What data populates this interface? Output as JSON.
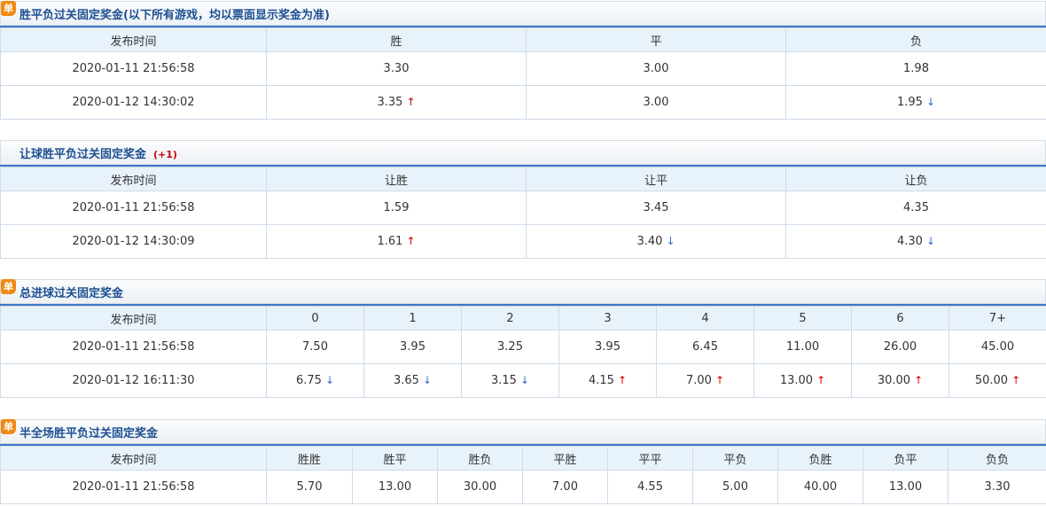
{
  "sections": [
    {
      "title": "胜平负过关固定奖金(以下所有游戏，均以票面显示奖金为准)",
      "badge": "单",
      "handicap": "",
      "headers": [
        "发布时间",
        "胜",
        "平",
        "负"
      ],
      "rows": [
        [
          {
            "v": "2020-01-11 21:56:58"
          },
          {
            "v": "3.30"
          },
          {
            "v": "3.00"
          },
          {
            "v": "1.98"
          }
        ],
        [
          {
            "v": "2020-01-12 14:30:02"
          },
          {
            "v": "3.35",
            "t": "up"
          },
          {
            "v": "3.00"
          },
          {
            "v": "1.95",
            "t": "down"
          }
        ]
      ]
    },
    {
      "title": "让球胜平负过关固定奖金",
      "badge": "",
      "handicap": "(+1)",
      "headers": [
        "发布时间",
        "让胜",
        "让平",
        "让负"
      ],
      "rows": [
        [
          {
            "v": "2020-01-11 21:56:58"
          },
          {
            "v": "1.59"
          },
          {
            "v": "3.45"
          },
          {
            "v": "4.35"
          }
        ],
        [
          {
            "v": "2020-01-12 14:30:09"
          },
          {
            "v": "1.61",
            "t": "up"
          },
          {
            "v": "3.40",
            "t": "down"
          },
          {
            "v": "4.30",
            "t": "down"
          }
        ]
      ]
    },
    {
      "title": "总进球过关固定奖金",
      "badge": "单",
      "handicap": "",
      "headers": [
        "发布时间",
        "0",
        "1",
        "2",
        "3",
        "4",
        "5",
        "6",
        "7+"
      ],
      "rows": [
        [
          {
            "v": "2020-01-11 21:56:58"
          },
          {
            "v": "7.50"
          },
          {
            "v": "3.95"
          },
          {
            "v": "3.25"
          },
          {
            "v": "3.95"
          },
          {
            "v": "6.45"
          },
          {
            "v": "11.00"
          },
          {
            "v": "26.00"
          },
          {
            "v": "45.00"
          }
        ],
        [
          {
            "v": "2020-01-12 16:11:30"
          },
          {
            "v": "6.75",
            "t": "down"
          },
          {
            "v": "3.65",
            "t": "down"
          },
          {
            "v": "3.15",
            "t": "down"
          },
          {
            "v": "4.15",
            "t": "up"
          },
          {
            "v": "7.00",
            "t": "up"
          },
          {
            "v": "13.00",
            "t": "up"
          },
          {
            "v": "30.00",
            "t": "up"
          },
          {
            "v": "50.00",
            "t": "up"
          }
        ]
      ]
    },
    {
      "title": "半全场胜平负过关固定奖金",
      "badge": "单",
      "handicap": "",
      "headers": [
        "发布时间",
        "胜胜",
        "胜平",
        "胜负",
        "平胜",
        "平平",
        "平负",
        "负胜",
        "负平",
        "负负"
      ],
      "rows": [
        [
          {
            "v": "2020-01-11 21:56:58"
          },
          {
            "v": "5.70"
          },
          {
            "v": "13.00"
          },
          {
            "v": "30.00"
          },
          {
            "v": "7.00"
          },
          {
            "v": "4.55"
          },
          {
            "v": "5.00"
          },
          {
            "v": "40.00"
          },
          {
            "v": "13.00"
          },
          {
            "v": "3.30"
          }
        ]
      ]
    }
  ],
  "icons": {
    "up": "↑",
    "down": "↓"
  },
  "colors": {
    "title": "#1d4f91",
    "up": "#d40000",
    "down": "#2f6fc0",
    "badge": "#f08a12",
    "header_bg": "#e8f2fb"
  }
}
